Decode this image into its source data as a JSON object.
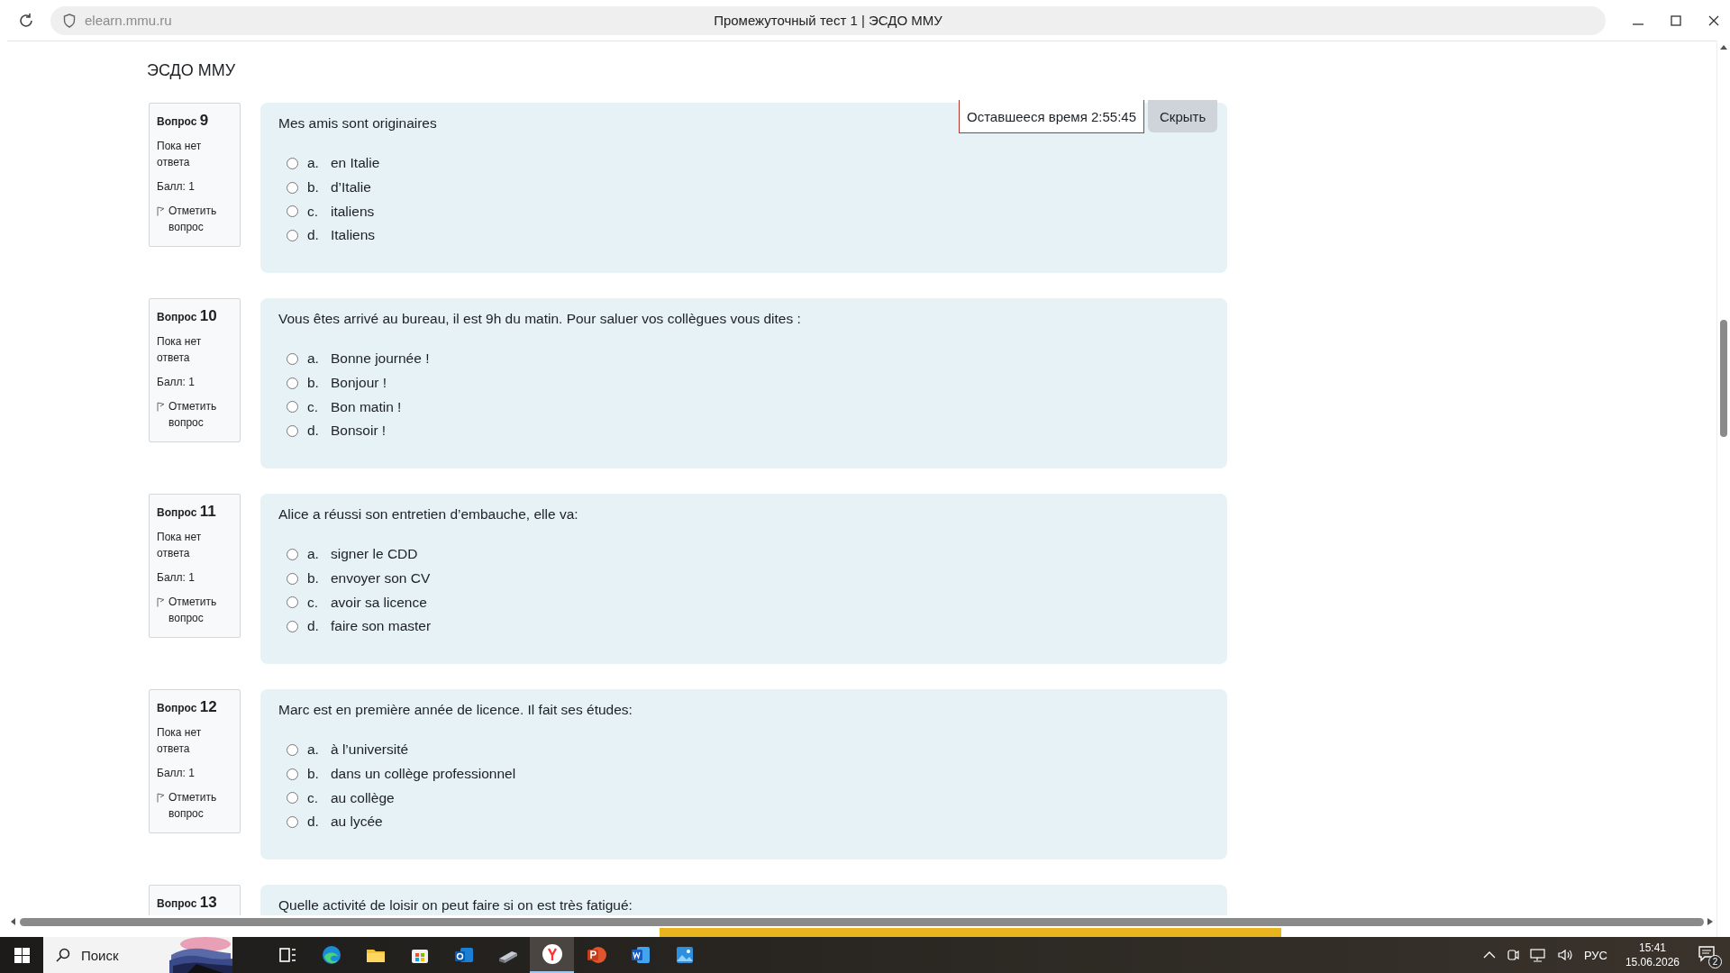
{
  "browser": {
    "address": "elearn.mmu.ru",
    "title": "Промежуточный тест 1 | ЭСДО ММУ"
  },
  "site": {
    "name": "ЭСДО ММУ"
  },
  "timer": {
    "text": "Оставшееся время 2:55:45",
    "hide_button": "Скрыть"
  },
  "questions": [
    {
      "label": "Вопрос",
      "number": "9",
      "status": "Пока нет ответа",
      "grade": "Балл: 1",
      "flag": "Отметить вопрос",
      "text": "Mes amis sont originaires",
      "options": [
        {
          "letter": "a.",
          "text": "en Italie",
          "selected": false
        },
        {
          "letter": "b.",
          "text": "d’Italie",
          "selected": false
        },
        {
          "letter": "c.",
          "text": "italiens",
          "selected": false
        },
        {
          "letter": "d.",
          "text": "Italiens",
          "selected": false
        }
      ]
    },
    {
      "label": "Вопрос",
      "number": "10",
      "status": "Пока нет ответа",
      "grade": "Балл: 1",
      "flag": "Отметить вопрос",
      "text": "Vous êtes arrivé au bureau, il est 9h du matin. Pour saluer vos collègues vous dites :",
      "options": [
        {
          "letter": "a.",
          "text": "Bonne journée !",
          "selected": false
        },
        {
          "letter": "b.",
          "text": "Bonjour !",
          "selected": false
        },
        {
          "letter": "c.",
          "text": "Bon matin !",
          "selected": false
        },
        {
          "letter": "d.",
          "text": "Bonsoir !",
          "selected": false
        }
      ]
    },
    {
      "label": "Вопрос",
      "number": "11",
      "status": "Пока нет ответа",
      "grade": "Балл: 1",
      "flag": "Отметить вопрос",
      "text": "Alice a réussi son entretien d’embauche, elle va:",
      "options": [
        {
          "letter": "a.",
          "text": "signer le CDD",
          "selected": false
        },
        {
          "letter": "b.",
          "text": "envoyer son CV",
          "selected": false
        },
        {
          "letter": "c.",
          "text": "avoir sa licence",
          "selected": false
        },
        {
          "letter": "d.",
          "text": "faire son master",
          "selected": false
        }
      ]
    },
    {
      "label": "Вопрос",
      "number": "12",
      "status": "Пока нет ответа",
      "grade": "Балл: 1",
      "flag": "Отметить вопрос",
      "text": "Marc est en première année de licence. Il fait ses études:",
      "options": [
        {
          "letter": "a.",
          "text": "à l’université",
          "selected": false
        },
        {
          "letter": "b.",
          "text": "dans un collège professionnel",
          "selected": false
        },
        {
          "letter": "c.",
          "text": "au collège",
          "selected": false
        },
        {
          "letter": "d.",
          "text": "au lycée",
          "selected": false
        }
      ]
    },
    {
      "label": "Вопрос",
      "number": "13",
      "text": "Quelle activité de loisir on peut faire si on est très fatigué:"
    }
  ],
  "taskbar": {
    "search": "Поиск",
    "apps": [
      {
        "kind": "taskview",
        "active": false
      },
      {
        "kind": "edge",
        "active": false
      },
      {
        "kind": "folder",
        "active": false
      },
      {
        "kind": "store",
        "active": false
      },
      {
        "kind": "outlook",
        "active": false
      },
      {
        "kind": "scanner",
        "active": false
      },
      {
        "kind": "yandex",
        "active": true
      },
      {
        "kind": "powerpoint",
        "active": false
      },
      {
        "kind": "word",
        "active": false
      },
      {
        "kind": "photos",
        "active": false
      }
    ],
    "language": "РУС",
    "time": "15:41",
    "date": "15.06.2026",
    "notifications": "2"
  }
}
